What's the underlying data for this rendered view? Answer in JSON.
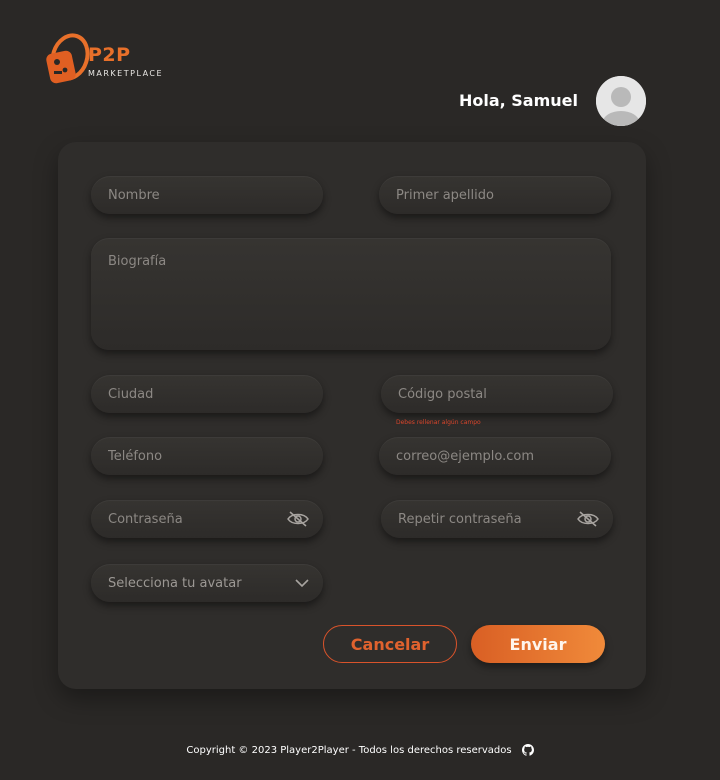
{
  "brand": {
    "title": "P2P",
    "subtitle": "MARKETPLACE",
    "accent_color": "#e8702a"
  },
  "header": {
    "greeting": "Hola, Samuel",
    "avatar_icon": "user-avatar-icon"
  },
  "form": {
    "nombre_placeholder": "Nombre",
    "apellido_placeholder": "Primer apellido",
    "biografia_placeholder": "Biografía",
    "ciudad_placeholder": "Ciudad",
    "codigo_postal_placeholder": "Código postal",
    "codigo_postal_error": "Debes rellenar algún campo",
    "telefono_placeholder": "Teléfono",
    "correo_placeholder": "correo@ejemplo.com",
    "contrasena_placeholder": "Contraseña",
    "repetir_contrasena_placeholder": "Repetir contraseña",
    "avatar_select_label": "Selecciona tu avatar",
    "password_toggle_icon": "eye-off-icon",
    "select_icon": "chevron-down-icon",
    "error_color": "#d9452b"
  },
  "actions": {
    "cancel_label": "Cancelar",
    "send_label": "Enviar"
  },
  "footer": {
    "copyright": "Copyright © 2023 Player2Player - Todos los derechos reservados",
    "github_icon": "github-icon"
  }
}
